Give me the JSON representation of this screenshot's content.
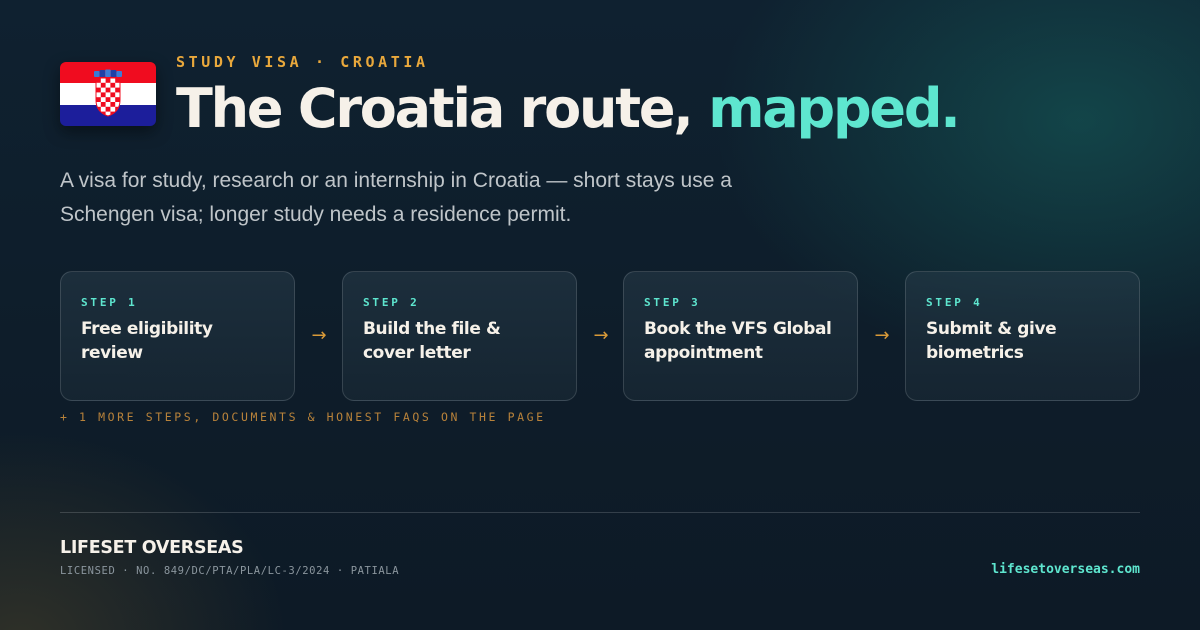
{
  "header": {
    "flag_icon": "croatia-flag-icon",
    "eyebrow": "STUDY VISA · CROATIA",
    "headline_main": "The Croatia route, ",
    "headline_accent": "mapped."
  },
  "lede": "A visa for study, research or an internship in Croatia — short stays use a Schengen visa; longer study needs a residence permit.",
  "steps": [
    {
      "number": "STEP 1",
      "title": "Free eligibility review"
    },
    {
      "number": "STEP 2",
      "title": "Build the file & cover letter"
    },
    {
      "number": "STEP 3",
      "title": "Book the VFS Global appointment"
    },
    {
      "number": "STEP 4",
      "title": "Submit & give biometrics"
    }
  ],
  "arrow_glyph": "→",
  "more_note": "+ 1 MORE STEPS, DOCUMENTS & HONEST FAQS ON THE PAGE",
  "footer": {
    "brand": "LIFESET OVERSEAS",
    "license": "LICENSED · NO. 849/DC/PTA/PLA/LC-3/2024 · PATIALA",
    "site": "lifesetoverseas.com"
  },
  "colors": {
    "accent_teal": "#5ee6cf",
    "accent_amber": "#e9a83c",
    "background": "#0f2130",
    "flag_red": "#f00c1f",
    "flag_blue": "#1c1e9b"
  }
}
